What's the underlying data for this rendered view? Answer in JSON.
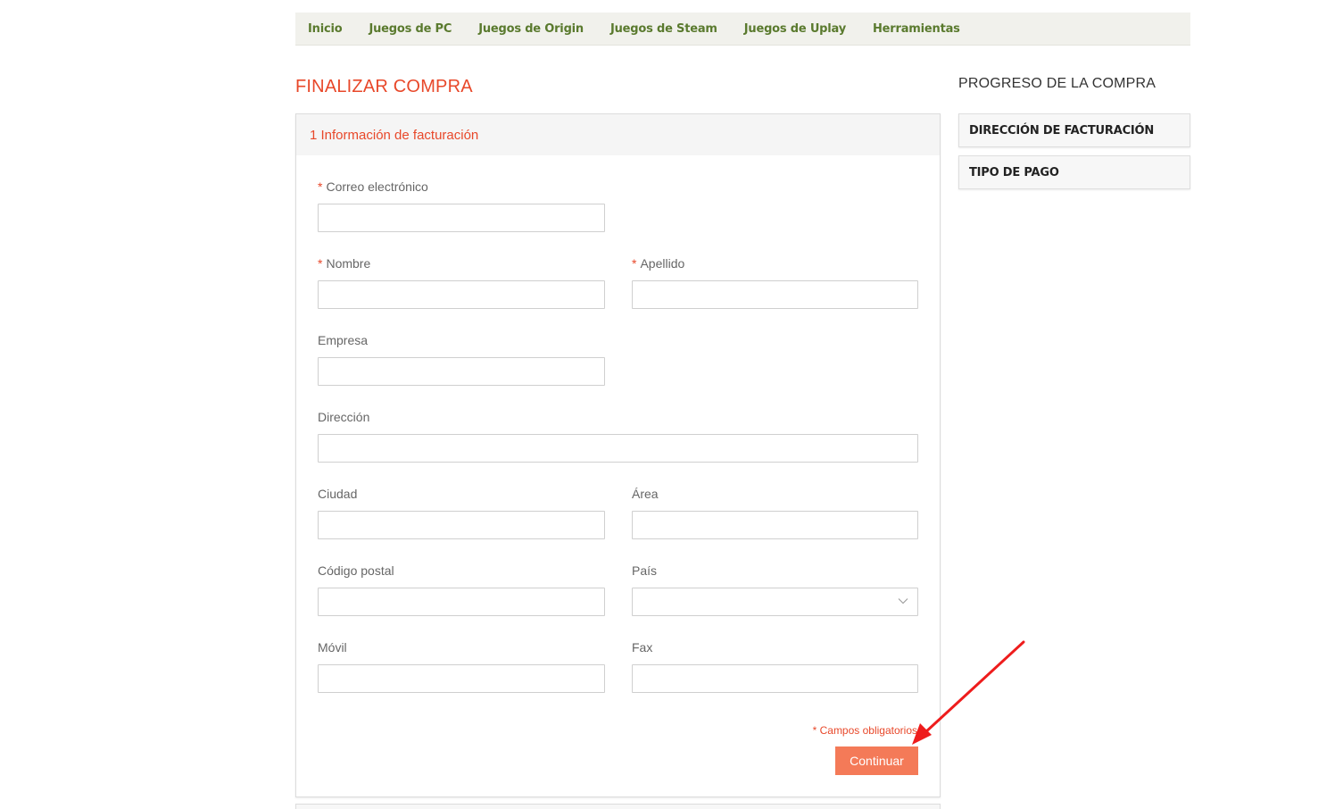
{
  "nav": {
    "items": [
      "Inicio",
      "Juegos de PC",
      "Juegos de Origin",
      "Juegos de Steam",
      "Juegos de Uplay",
      "Herramientas"
    ]
  },
  "page_title": "FINALIZAR COMPRA",
  "section": {
    "title": "1 Información de facturación"
  },
  "form": {
    "required_mark": "*",
    "email_label": "Correo electrónico",
    "first_name_label": "Nombre",
    "last_name_label": "Apellido",
    "company_label": "Empresa",
    "address_label": "Dirección",
    "city_label": "Ciudad",
    "area_label": "Área",
    "postal_code_label": "Código postal",
    "country_label": "País",
    "mobile_label": "Móvil",
    "fax_label": "Fax",
    "email_value": "",
    "first_name_value": "",
    "last_name_value": "",
    "company_value": "",
    "address_value": "",
    "city_value": "",
    "area_value": "",
    "postal_code_value": "",
    "country_value": "",
    "mobile_value": "",
    "fax_value": "",
    "required_note": "* Campos obligatorios",
    "continue_label": "Continuar"
  },
  "sidebar": {
    "title": "PROGRESO DE LA COMPRA",
    "steps": [
      "DIRECCIÓN DE FACTURACIÓN",
      "TIPO DE PAGO"
    ]
  },
  "icons": {
    "country_select": "chevron-down-icon",
    "annotation": "red-arrow-icon"
  },
  "colors": {
    "accent": "#e8482a",
    "button": "#f47a58",
    "nav_text": "#5a7a2e",
    "nav_bg": "#f1f1ec",
    "annotation_arrow": "#ee1c1c"
  }
}
